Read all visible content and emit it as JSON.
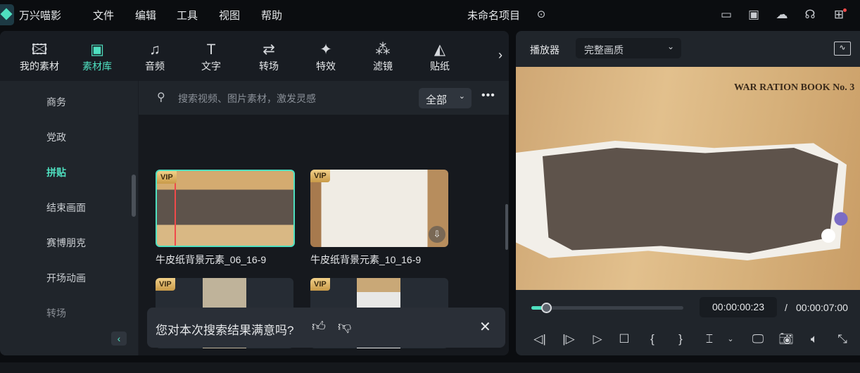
{
  "app": {
    "name": "万兴喵影",
    "project_title": "未命名项目"
  },
  "menu": [
    "文件",
    "编辑",
    "工具",
    "视图",
    "帮助"
  ],
  "toolbar": [
    {
      "label": "我的素材",
      "icon": "image-icon"
    },
    {
      "label": "素材库",
      "icon": "cloud-folder-icon"
    },
    {
      "label": "音频",
      "icon": "music-icon"
    },
    {
      "label": "文字",
      "icon": "text-icon"
    },
    {
      "label": "转场",
      "icon": "transition-icon"
    },
    {
      "label": "特效",
      "icon": "effects-icon"
    },
    {
      "label": "滤镜",
      "icon": "filter-icon"
    },
    {
      "label": "贴纸",
      "icon": "sticker-icon"
    }
  ],
  "categories": [
    "商务",
    "党政",
    "拼贴",
    "结束画面",
    "赛博朋克",
    "开场动画",
    "转场"
  ],
  "active_category": "拼贴",
  "search": {
    "placeholder": "搜索视频、图片素材，激发灵感",
    "filter": "全部"
  },
  "cards": [
    {
      "name": "牛皮纸背景元素_06_16-9",
      "badge": "VIP"
    },
    {
      "name": "牛皮纸背景元素_10_16-9",
      "badge": "VIP"
    },
    {
      "name": "",
      "badge": "VIP"
    },
    {
      "name": "",
      "badge": "VIP"
    }
  ],
  "feedback": {
    "question": "您对本次搜索结果满意吗?"
  },
  "player": {
    "label": "播放器",
    "quality": "完整画质",
    "current_time": "00:00:00:23",
    "separator": "/",
    "total_time": "00:00:07:00",
    "progress": 0.05
  },
  "video_text": {
    "title": "WAR RATION BOOK No. 3"
  },
  "colors": {
    "accent": "#4fe0c0",
    "bg": "#0b0d10",
    "panel": "#20252b"
  }
}
